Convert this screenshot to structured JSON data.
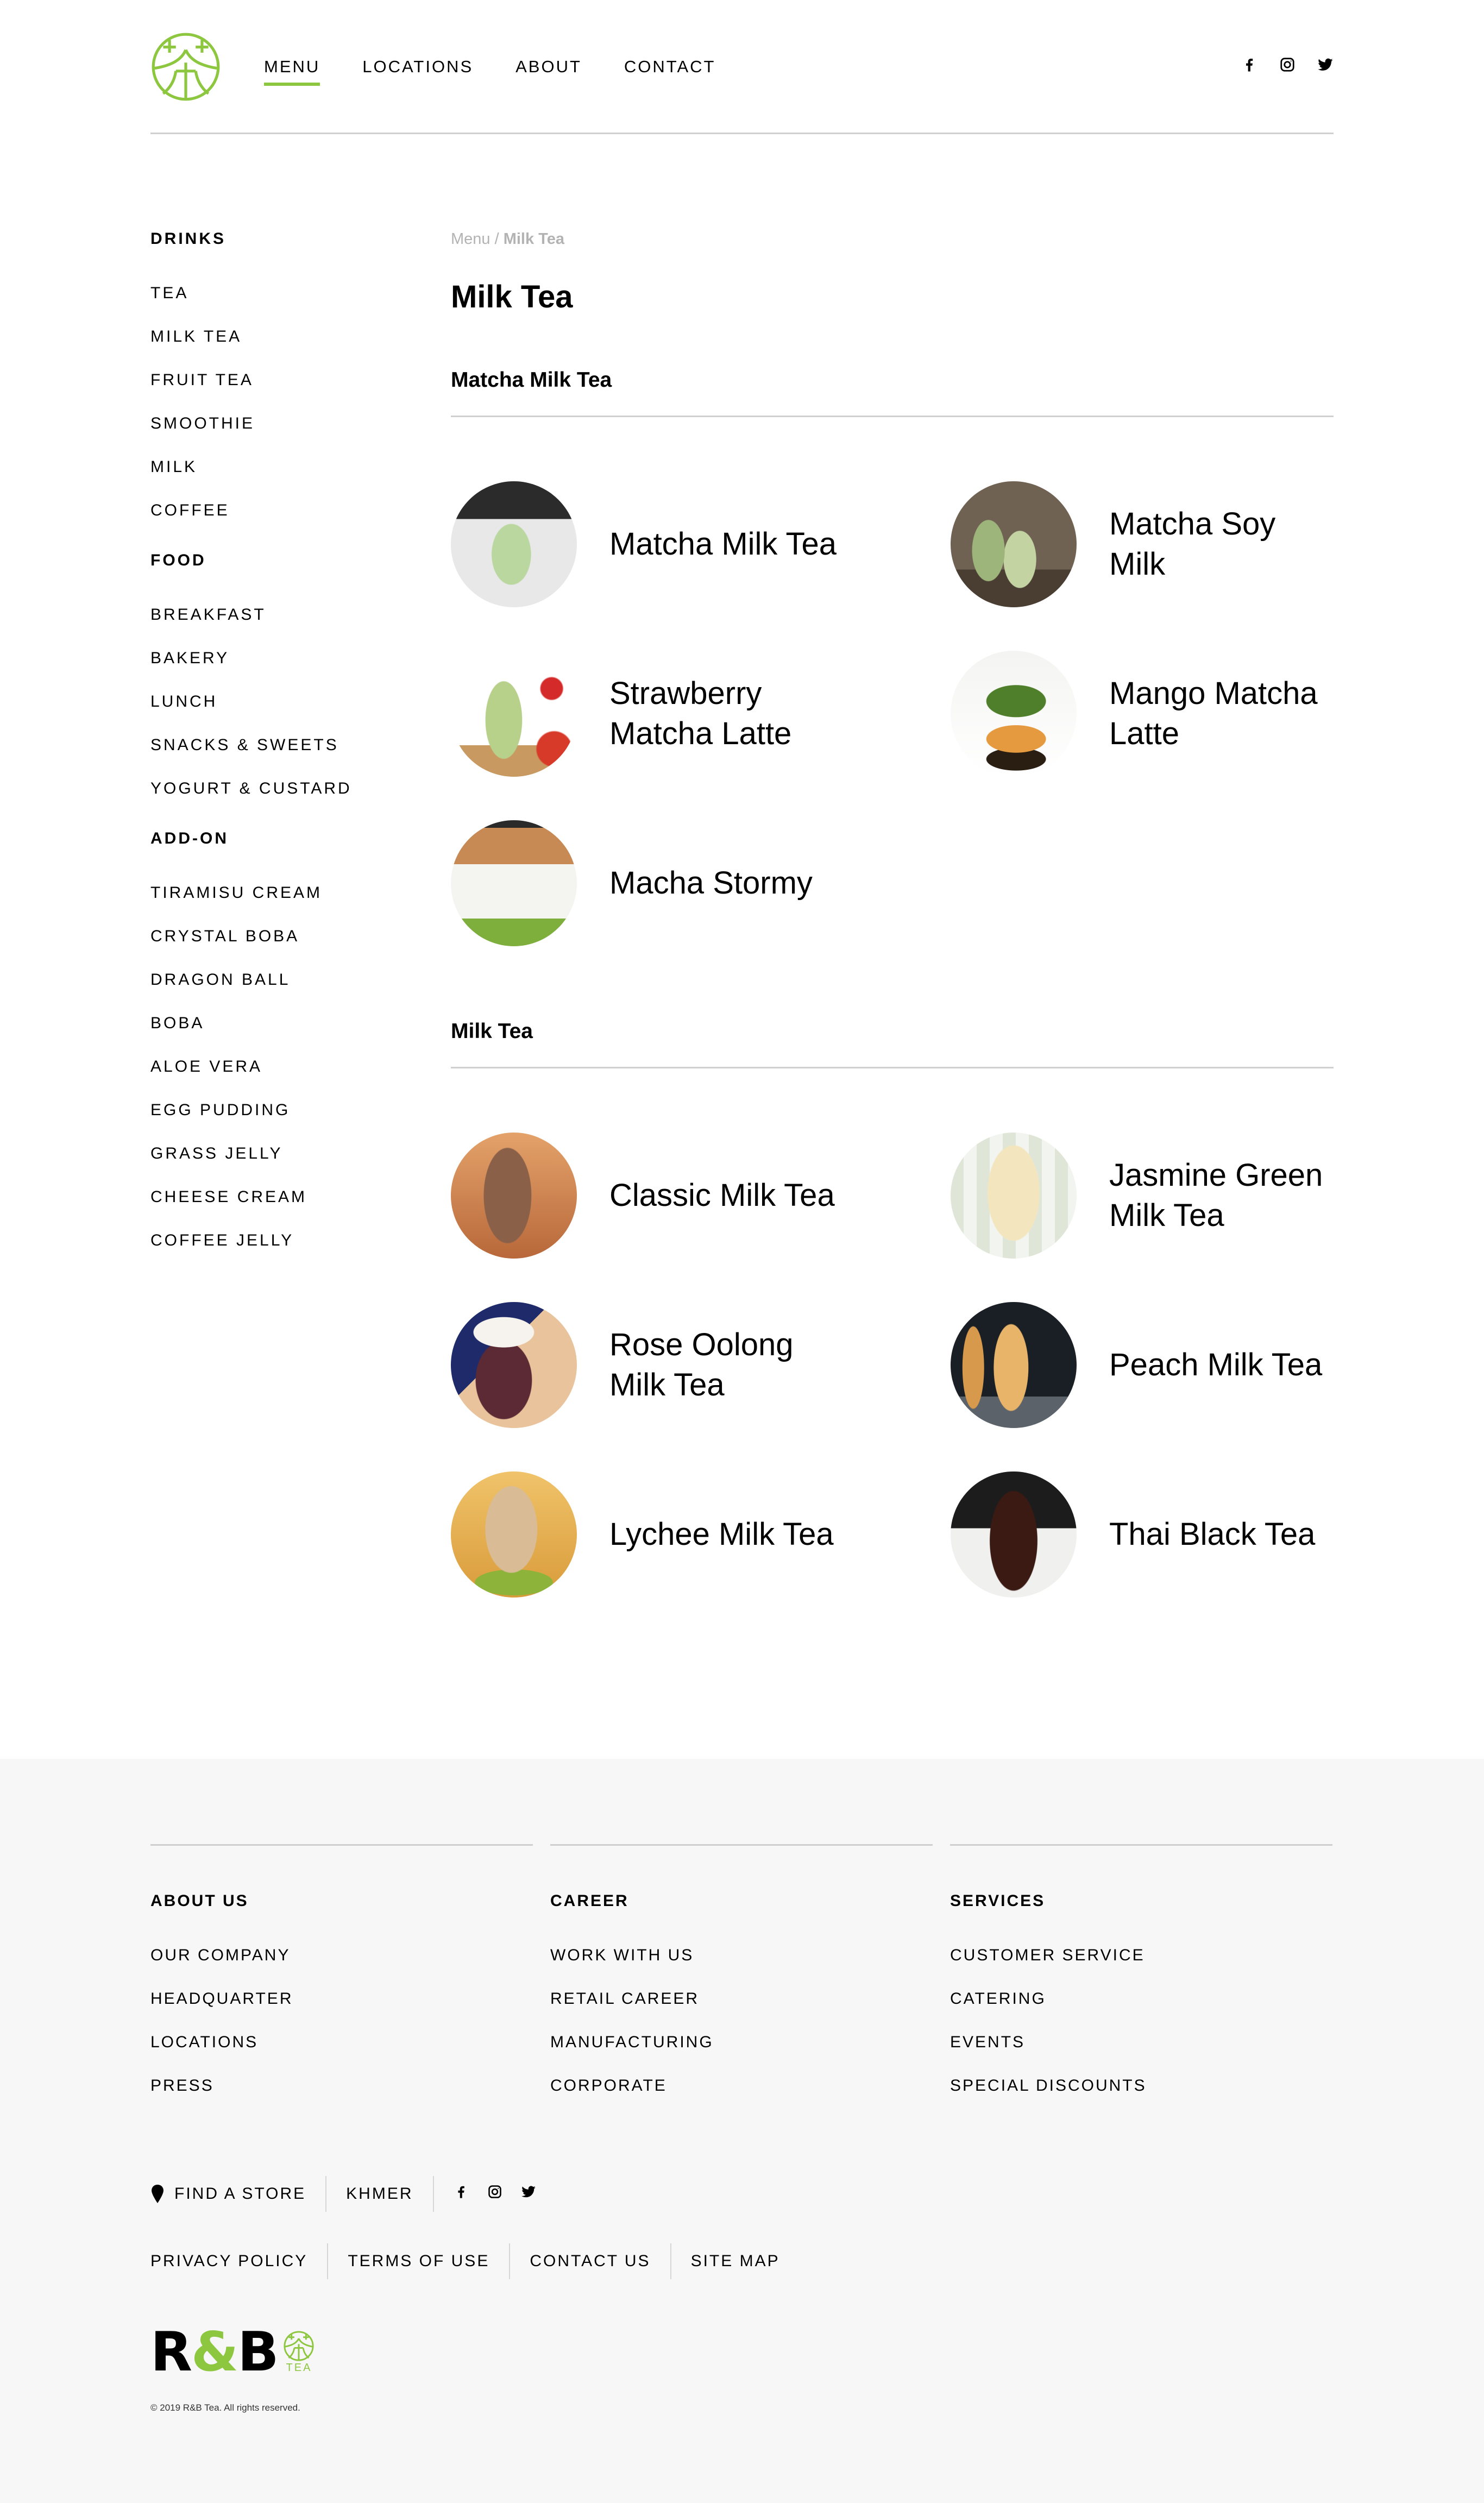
{
  "brand": {
    "name": "R&B Tea",
    "logo_icon": "tea-character-circle-logo",
    "accent_color": "#8dc63f",
    "footer_logo_text_left": "R",
    "footer_logo_text_amp": "&",
    "footer_logo_text_right": "B",
    "footer_logo_sub": "TEA"
  },
  "header": {
    "nav": [
      {
        "label": "MENU",
        "active": true
      },
      {
        "label": "LOCATIONS",
        "active": false
      },
      {
        "label": "ABOUT",
        "active": false
      },
      {
        "label": "CONTACT",
        "active": false
      }
    ],
    "social": [
      "facebook-icon",
      "instagram-icon",
      "twitter-icon"
    ]
  },
  "sidebar": {
    "groups": [
      {
        "title": "DRINKS",
        "items": [
          "TEA",
          "MILK TEA",
          "FRUIT TEA",
          "SMOOTHIE",
          "MILK",
          "COFFEE"
        ]
      },
      {
        "title": "FOOD",
        "items": [
          "BREAKFAST",
          "BAKERY",
          "LUNCH",
          "SNACKS & SWEETS",
          "YOGURT & CUSTARD"
        ]
      },
      {
        "title": "ADD-ON",
        "items": [
          "TIRAMISU CREAM",
          "CRYSTAL BOBA",
          "DRAGON BALL",
          "BOBA",
          "ALOE VERA",
          "EGG PUDDING",
          "GRASS JELLY",
          "CHEESE CREAM",
          "COFFEE JELLY"
        ]
      }
    ]
  },
  "main": {
    "breadcrumb": {
      "root": "Menu",
      "separator": " / ",
      "current": "Milk Tea"
    },
    "title": "Milk Tea",
    "sections": [
      {
        "title": "Matcha Milk Tea",
        "products": [
          {
            "name": "Matcha Milk Tea",
            "image": "matcha-milk-tea-photo"
          },
          {
            "name": "Matcha Soy Milk",
            "image": "matcha-soy-milk-photo"
          },
          {
            "name": "Strawberry Matcha Latte",
            "image": "strawberry-matcha-latte-photo"
          },
          {
            "name": "Mango Matcha Latte",
            "image": "mango-matcha-latte-photo"
          },
          {
            "name": "Macha Stormy",
            "image": "macha-stormy-photo"
          }
        ]
      },
      {
        "title": "Milk Tea",
        "products": [
          {
            "name": "Classic Milk Tea",
            "image": "classic-milk-tea-photo"
          },
          {
            "name": "Jasmine Green Milk Tea",
            "image": "jasmine-green-milk-tea-photo"
          },
          {
            "name": "Rose Oolong Milk Tea",
            "image": "rose-oolong-milk-tea-photo"
          },
          {
            "name": "Peach Milk Tea",
            "image": "peach-milk-tea-photo"
          },
          {
            "name": "Lychee Milk Tea",
            "image": "lychee-milk-tea-photo"
          },
          {
            "name": "Thai Black Tea",
            "image": "thai-black-tea-photo"
          }
        ]
      }
    ]
  },
  "footer": {
    "columns": [
      {
        "title": "ABOUT US",
        "links": [
          "OUR COMPANY",
          "HEADQUARTER",
          "LOCATIONS",
          "PRESS"
        ]
      },
      {
        "title": "CAREER",
        "links": [
          "WORK WITH US",
          "RETAIL CAREER",
          "MANUFACTURING",
          "CORPORATE"
        ]
      },
      {
        "title": "SERVICES",
        "links": [
          "CUSTOMER SERVICE",
          "CATERING",
          "EVENTS",
          "SPECIAL DISCOUNTS"
        ]
      }
    ],
    "find_store": "FIND A STORE",
    "language": "KHMER",
    "social": [
      "facebook-icon",
      "instagram-icon",
      "twitter-icon"
    ],
    "legal_links": [
      "PRIVACY POLICY",
      "TERMS OF USE",
      "CONTACT US",
      "SITE MAP"
    ],
    "copyright": "© 2019 R&B Tea. All rights reserved."
  }
}
